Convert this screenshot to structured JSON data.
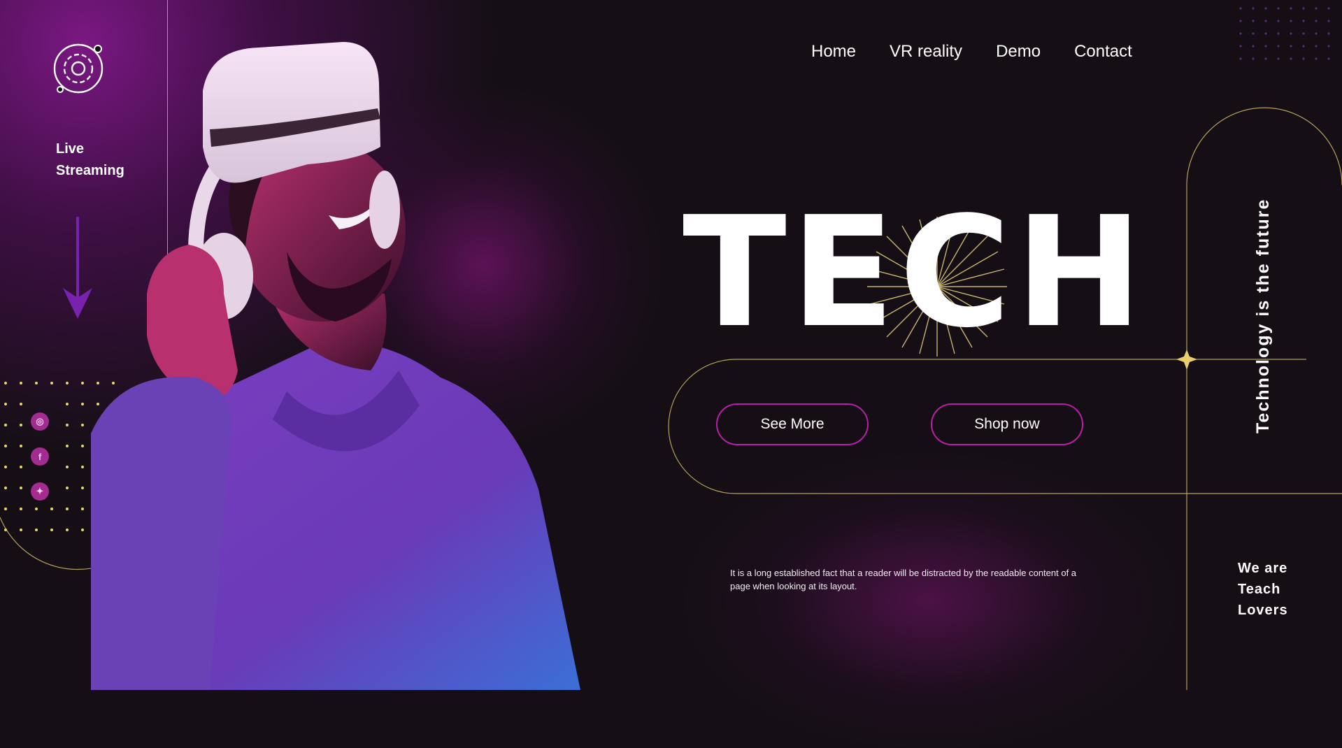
{
  "nav": {
    "items": [
      {
        "label": "Home"
      },
      {
        "label": "VR reality"
      },
      {
        "label": "Demo"
      },
      {
        "label": "Contact"
      }
    ]
  },
  "sidebar": {
    "live_line1": "Live",
    "live_line2": "Streaming",
    "social": [
      {
        "icon": "instagram-icon",
        "glyph": "◎"
      },
      {
        "icon": "facebook-icon",
        "glyph": "f"
      },
      {
        "icon": "twitter-icon",
        "glyph": "✦"
      }
    ]
  },
  "hero": {
    "title": "TECH",
    "buttons": {
      "see_more": "See More",
      "shop_now": "Shop now"
    },
    "tagline": "Technology is the future",
    "description": "It is a long established fact that a reader will be distracted by the readable content of a page when looking at its layout.",
    "lovers_line1": "We are",
    "lovers_line2": "Teach",
    "lovers_line3": "Lovers"
  },
  "colors": {
    "background": "#150f15",
    "accent_magenta": "#b71eae",
    "accent_purple": "#7a22b0",
    "gold_line": "#b6a159",
    "dot_yellow": "#e8d866"
  }
}
